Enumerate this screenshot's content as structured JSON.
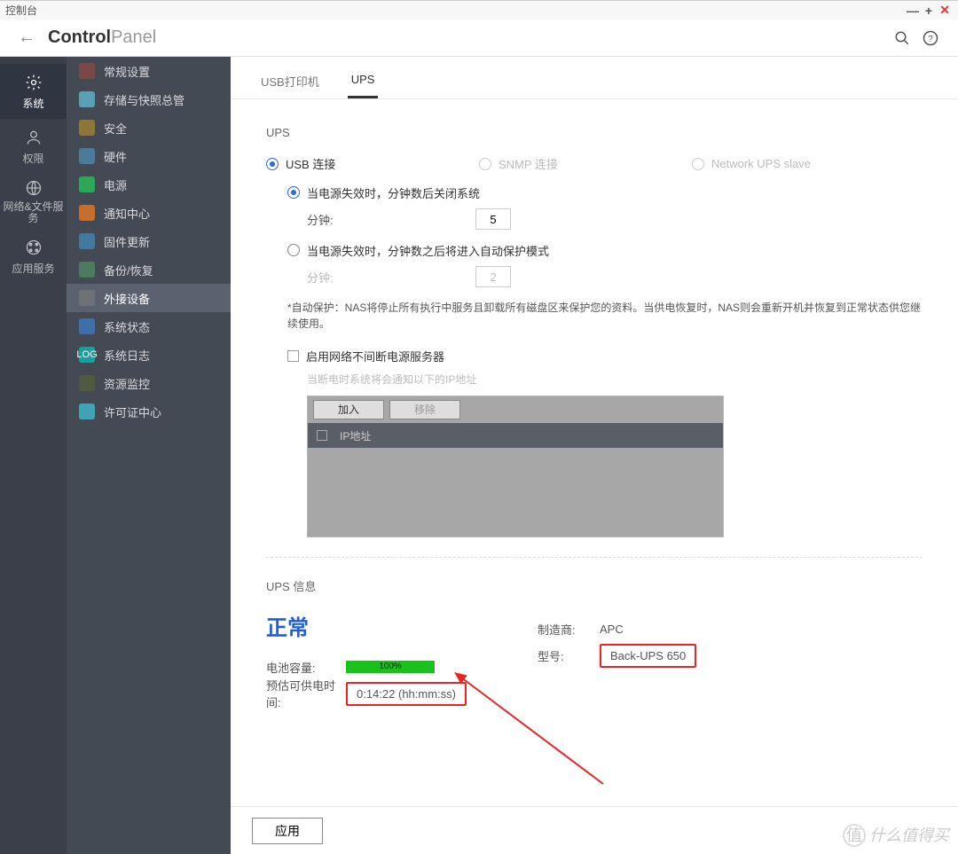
{
  "titlebar": {
    "title": "控制台"
  },
  "header": {
    "title_bold": "Control",
    "title_light": "Panel"
  },
  "nav": {
    "items": [
      {
        "label": "系统"
      },
      {
        "label": "权限"
      },
      {
        "label": "网络&文件服务"
      },
      {
        "label": "应用服务"
      }
    ]
  },
  "sidebar": {
    "items": [
      {
        "label": "常规设置",
        "color": "#7b4848"
      },
      {
        "label": "存储与快照总管",
        "color": "#5aa0b4"
      },
      {
        "label": "安全",
        "color": "#8c7737"
      },
      {
        "label": "硬件",
        "color": "#4a7b9b"
      },
      {
        "label": "电源",
        "color": "#2da858"
      },
      {
        "label": "通知中心",
        "color": "#c66f2a"
      },
      {
        "label": "固件更新",
        "color": "#417a9e"
      },
      {
        "label": "备份/恢复",
        "color": "#4c7c5f"
      },
      {
        "label": "外接设备",
        "color": "#6d7279"
      },
      {
        "label": "系统状态",
        "color": "#3e6fa9"
      },
      {
        "label": "系统日志",
        "color": "#1a9ea0"
      },
      {
        "label": "资源监控",
        "color": "#4f5a3e"
      },
      {
        "label": "许可证中心",
        "color": "#3fa3b6"
      }
    ]
  },
  "tabs": {
    "items": [
      "USB打印机",
      "UPS"
    ]
  },
  "ups": {
    "section_title": "UPS",
    "conn": {
      "usb": "USB 连接",
      "snmp": "SNMP 连接",
      "slave": "Network UPS slave"
    },
    "opt1": "当电源失效时，分钟数后关闭系统",
    "opt2": "当电源失效时，分钟数之后将进入自动保护模式",
    "minute_label": "分钟:",
    "minute_value1": "5",
    "minute_value2": "2",
    "auto_note": "*自动保护：NAS将停止所有执行中服务且卸载所有磁盘区来保护您的资料。当供电恢复时，NAS则会重新开机并恢复到正常状态供您继续使用。",
    "enable_nut": "启用网络不间断电源服务器",
    "nut_note": "当断电时系统将会通知以下的IP地址",
    "ip_panel": {
      "add": "加入",
      "remove": "移除",
      "header": "IP地址"
    }
  },
  "ups_info": {
    "title": "UPS 信息",
    "status": "正常",
    "battery_label": "电池容量:",
    "battery_pct": "100%",
    "est_label": "预估可供电时间:",
    "est_value": "0:14:22 (hh:mm:ss)",
    "mfr_label": "制造商:",
    "mfr_value": "APC",
    "model_label": "型号:",
    "model_value": "Back-UPS 650"
  },
  "footer": {
    "apply": "应用"
  },
  "watermark": "什么值得买"
}
